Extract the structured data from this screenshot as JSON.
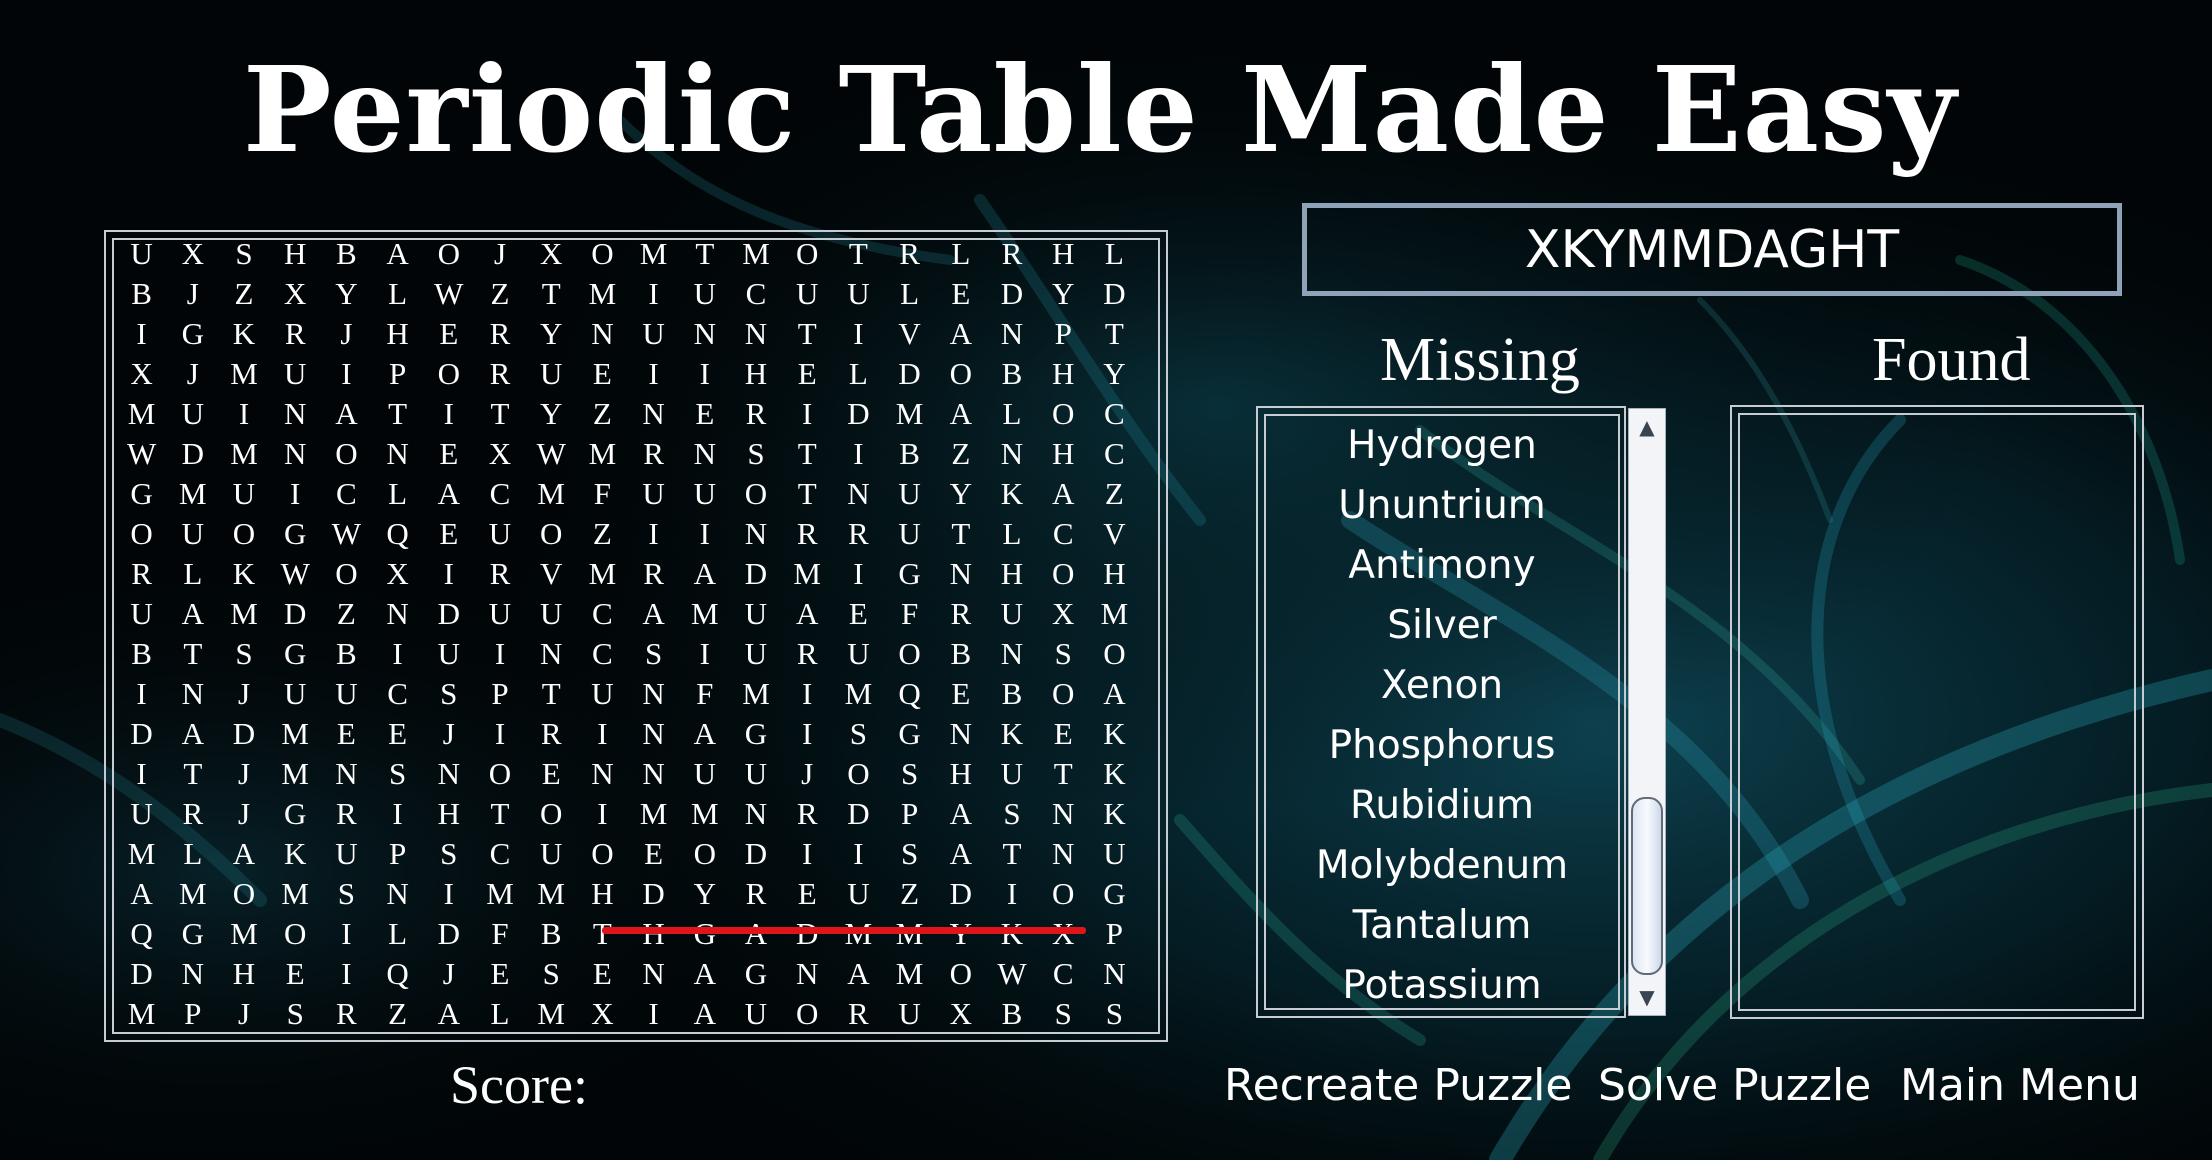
{
  "title": "Periodic Table Made Easy",
  "current_word": "XKYMMDAGHT",
  "headers": {
    "missing": "Missing",
    "found": "Found"
  },
  "missing_words": [
    "Hydrogen",
    "Ununtrium",
    "Antimony",
    "Silver",
    "Xenon",
    "Phosphorus",
    "Rubidium",
    "Molybdenum",
    "Tantalum",
    "Potassium"
  ],
  "found_words": [],
  "score_label": "Score:",
  "buttons": {
    "recreate": "Recreate Puzzle",
    "solve": "Solve Puzzle",
    "main_menu": "Main Menu"
  },
  "grid_rows": [
    "UXSHBAOJXOMTMOTRLRHL",
    "BJZXYLWZTMIUCUULEDYD",
    "IGKRJHERYNUNNTIVANPT",
    "XJMUIPORUEIIHELDOBHY",
    "MUINATITYZNERIDMALOC",
    "WDMNONEXWMRNSTIBZNHC",
    "GMUICLACMFUUOTNUYKAZ",
    "OUOGWQEUOZIINRRUTLCV",
    "RLKWOXIRVMRADMIGNHOH",
    "UAMDZNDUUCAMUAEFRUXM",
    "BTSGBIUINCSIURUOBNSO",
    "INJUUCSPTUNFMIMQEBOA",
    "DADMEEJIRINAGISGNKEK",
    "ITJMNSNOENNUUJOSHUTK",
    "URJGRIHTOIMMNRDPASNK",
    "MLAKUPSCUOEODIISATNU",
    "AMOMSNIMMHDYREUZDIOG",
    "QGMOILDFBTHGADMMYKXP",
    "DNHEIQJESENAGNAMOWCN",
    "MPJSRZALMXIAUORUXBSS"
  ],
  "colors": {
    "highlight_line": "#e0141b",
    "frame": "#c6ccd2",
    "word_box_border": "#8fa2b7"
  }
}
